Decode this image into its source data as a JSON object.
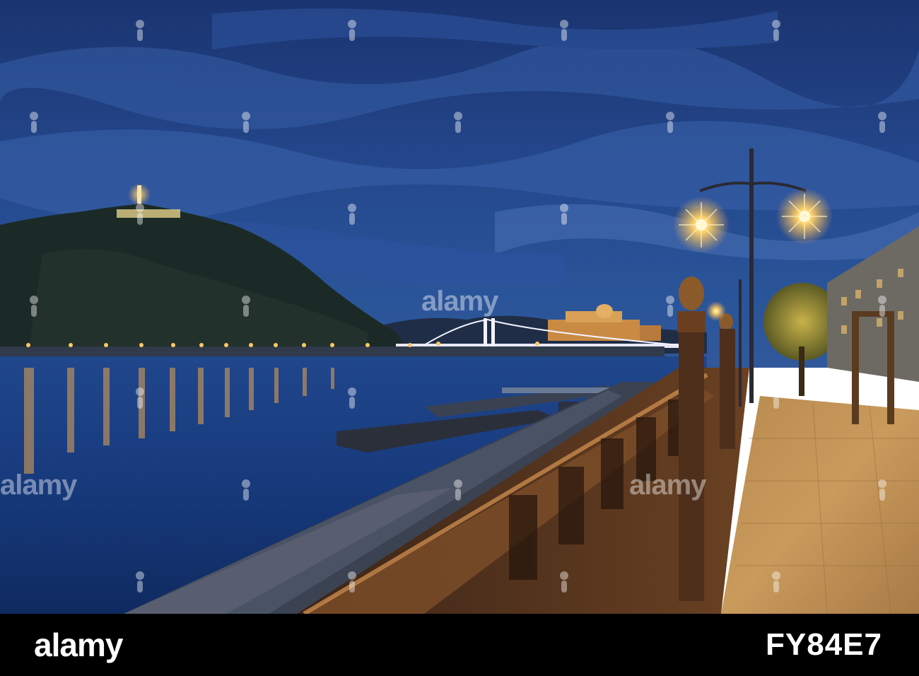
{
  "photo": {
    "description_label": "Budapest Danube embankment at dusk"
  },
  "watermark": {
    "text": "alamy"
  },
  "footer": {
    "brand": "alamy",
    "image_id": "FY84E7"
  },
  "colors": {
    "sky": "#1f3f80",
    "water": "#14326e",
    "lamp": "#ffd36a",
    "footer": "#000000"
  }
}
